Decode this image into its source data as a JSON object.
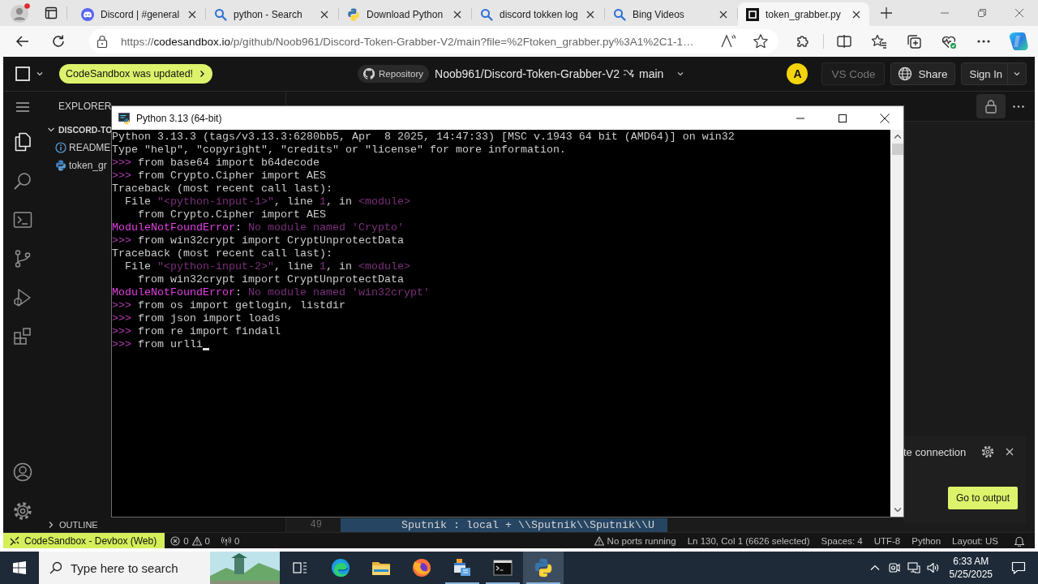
{
  "browser": {
    "tabs": [
      {
        "title": "Discord | #general",
        "kind": "discord",
        "selected": false
      },
      {
        "title": "python - Search",
        "kind": "search",
        "selected": false
      },
      {
        "title": "Download Python",
        "kind": "python",
        "selected": false
      },
      {
        "title": "discord tokken log",
        "kind": "search",
        "selected": false
      },
      {
        "title": "Bing Videos",
        "kind": "search",
        "selected": false
      },
      {
        "title": "token_grabber.py",
        "kind": "codesandbox",
        "selected": true
      }
    ],
    "address": {
      "scheme": "https://",
      "host": "codesandbox.io",
      "rest": "/p/github/Noob961/Discord-Token-Grabber-V2/main?file=%2Ftoken_grabber.py%3A1%2C1-1…"
    }
  },
  "app": {
    "header": {
      "notice": "CodeSandbox was updated!",
      "repo_label": "Repository",
      "repo": "Noob961/Discord-Token-Grabber-V2",
      "branch": "main",
      "avatar": "A",
      "buttons": [
        {
          "label": "VS Code",
          "kind": "plain",
          "disabled": true
        },
        {
          "label": "Share",
          "kind": "share",
          "disabled": false
        },
        {
          "label": "Sign In",
          "kind": "split",
          "disabled": false
        }
      ]
    },
    "activity_bar": [
      {
        "kind": "files",
        "selected": true
      },
      {
        "kind": "search",
        "selected": false
      },
      {
        "kind": "terminal",
        "selected": false
      },
      {
        "kind": "source-control",
        "selected": false
      },
      {
        "kind": "run-debug",
        "selected": false
      },
      {
        "kind": "extensions",
        "selected": false
      }
    ],
    "explorer": {
      "title": "EXPLORER",
      "tree": [
        {
          "label": "DISCORD-TO",
          "expanded": true,
          "children": [
            {
              "label": "README",
              "kind": "info"
            },
            {
              "label": "token_gr",
              "kind": "python"
            }
          ]
        }
      ],
      "outline": "OUTLINE"
    },
    "editor": {
      "code_line": {
        "number": "49",
        "text": "Sputnik : local + \\\\Sputnik\\\\Sputnik\\\\U",
        "selected": true
      }
    }
  },
  "console": {
    "title": "Python 3.13 (64-bit)",
    "cursor": true,
    "lines": [
      [
        {
          "kind": "plain",
          "text": "Python 3.13.3 (tags/v3.13.3:6280bb5, Apr  8 2025, 14:47:33) [MSC v.1943 64 bit (AMD64)] on win32"
        }
      ],
      [
        {
          "kind": "plain",
          "text": "Type \"help\", \"copyright\", \"credits\" or \"license\" for more information."
        }
      ],
      [
        {
          "kind": "prompt",
          "text": ">>>"
        },
        {
          "kind": "plain",
          "text": " from base64 import b64decode"
        }
      ],
      [
        {
          "kind": "prompt",
          "text": ">>>"
        },
        {
          "kind": "plain",
          "text": " from Crypto.Cipher import AES"
        }
      ],
      [
        {
          "kind": "plain",
          "text": "Traceback (most recent call last):"
        }
      ],
      [
        {
          "kind": "plain",
          "text": "  File "
        },
        {
          "kind": "dim",
          "text": "\"<python-input-1>\""
        },
        {
          "kind": "plain",
          "text": ", line "
        },
        {
          "kind": "dim",
          "text": "1"
        },
        {
          "kind": "plain",
          "text": ", in "
        },
        {
          "kind": "dim",
          "text": "<module>"
        }
      ],
      [
        {
          "kind": "plain",
          "text": "    from Crypto.Cipher import AES"
        }
      ],
      [
        {
          "kind": "error",
          "text": "ModuleNotFoundError"
        },
        {
          "kind": "plain",
          "text": ": "
        },
        {
          "kind": "dim",
          "text": "No module named 'Crypto'"
        }
      ],
      [
        {
          "kind": "prompt",
          "text": ">>>"
        },
        {
          "kind": "plain",
          "text": " from win32crypt import CryptUnprotectData"
        }
      ],
      [
        {
          "kind": "plain",
          "text": "Traceback (most recent call last):"
        }
      ],
      [
        {
          "kind": "plain",
          "text": "  File "
        },
        {
          "kind": "dim",
          "text": "\"<python-input-2>\""
        },
        {
          "kind": "plain",
          "text": ", line "
        },
        {
          "kind": "dim",
          "text": "1"
        },
        {
          "kind": "plain",
          "text": ", in "
        },
        {
          "kind": "dim",
          "text": "<module>"
        }
      ],
      [
        {
          "kind": "plain",
          "text": "    from win32crypt import CryptUnprotectData"
        }
      ],
      [
        {
          "kind": "error",
          "text": "ModuleNotFoundError"
        },
        {
          "kind": "plain",
          "text": ": "
        },
        {
          "kind": "dim",
          "text": "No module named 'win32crypt'"
        }
      ],
      [
        {
          "kind": "prompt",
          "text": ">>>"
        },
        {
          "kind": "plain",
          "text": " from os import getlogin, listdir"
        }
      ],
      [
        {
          "kind": "prompt",
          "text": ">>>"
        },
        {
          "kind": "plain",
          "text": " from json import loads"
        }
      ],
      [
        {
          "kind": "prompt",
          "text": ">>>"
        },
        {
          "kind": "plain",
          "text": " from re import findall"
        }
      ],
      [
        {
          "kind": "prompt",
          "text": ">>>"
        },
        {
          "kind": "plain",
          "text": " from urlli"
        }
      ]
    ]
  },
  "notification": {
    "text": "te connection",
    "button": "Go to output"
  },
  "status_bar": {
    "left": [
      {
        "kind": "remote",
        "text": "CodeSandbox - Devbox (Web)"
      },
      {
        "kind": "problems",
        "errors": "0",
        "warnings": "0"
      },
      {
        "kind": "ports",
        "text": "0"
      }
    ],
    "right": [
      {
        "kind": "warning",
        "text": "No ports running"
      },
      {
        "kind": "text",
        "text": "Ln 130, Col 1 (6626 selected)"
      },
      {
        "kind": "text",
        "text": "Spaces: 4"
      },
      {
        "kind": "text",
        "text": "UTF-8"
      },
      {
        "kind": "text",
        "text": "Python"
      },
      {
        "kind": "text",
        "text": "Layout: US"
      },
      {
        "kind": "bell"
      }
    ]
  },
  "taskbar": {
    "search_placeholder": "Type here to search",
    "apps": [
      {
        "kind": "task-view",
        "running": false,
        "selected": false
      },
      {
        "kind": "edge",
        "running": false,
        "selected": false
      },
      {
        "kind": "explorer",
        "running": false,
        "selected": false
      },
      {
        "kind": "firefox",
        "running": false,
        "selected": false
      },
      {
        "kind": "app",
        "running": true,
        "selected": false
      },
      {
        "kind": "terminal",
        "running": true,
        "selected": false
      },
      {
        "kind": "python",
        "running": true,
        "selected": true
      }
    ],
    "time": "6:33 AM",
    "date": "5/25/2025"
  }
}
